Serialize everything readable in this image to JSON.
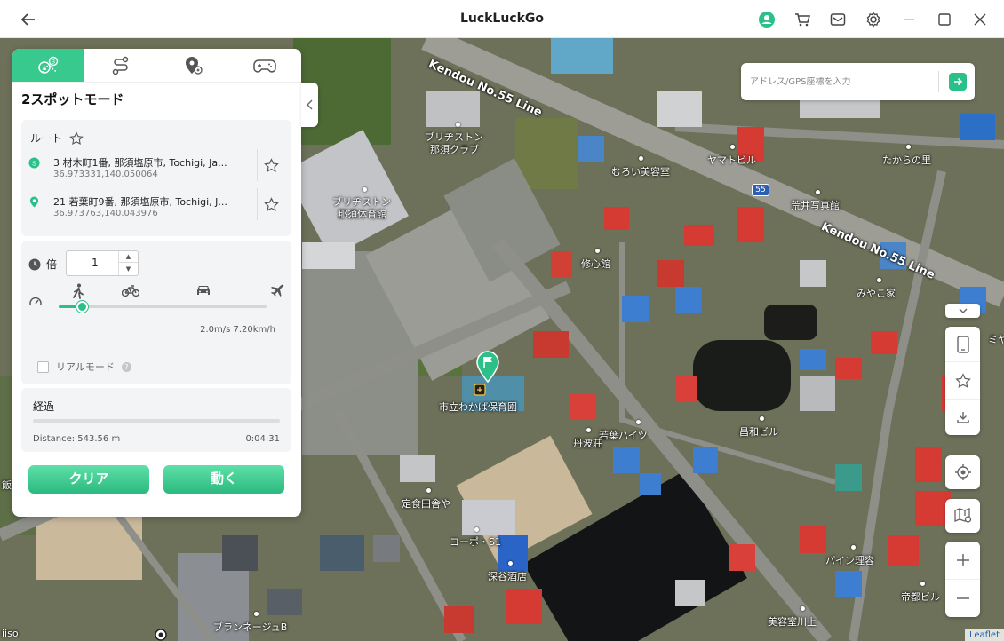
{
  "app": {
    "title": "LuckLuckGo"
  },
  "titlebar": {
    "icons": [
      "back-arrow-icon",
      "user-icon",
      "cart-icon",
      "mail-icon",
      "gear-icon",
      "minimize-icon",
      "maximize-icon",
      "close-icon"
    ]
  },
  "search": {
    "placeholder": "アドレス/GPS座標を入力",
    "value": ""
  },
  "panel": {
    "tabs": [
      {
        "icon": "two-spot-icon",
        "active": true
      },
      {
        "icon": "multi-spot-icon",
        "active": false
      },
      {
        "icon": "teleport-icon",
        "active": false
      },
      {
        "icon": "gamepad-icon",
        "active": false
      }
    ],
    "mode_title": "2スポットモード",
    "route": {
      "label": "ルート",
      "start": {
        "address": "3 材木町1番, 那須塩原市, Tochigi, Ja...",
        "coords": "36.973331,140.050064"
      },
      "end": {
        "address": "21 若葉町9番, 那須塩原市, Tochigi, J...",
        "coords": "36.973763,140.043976"
      }
    },
    "speed": {
      "multiplier_label": "倍",
      "multiplier_value": "1",
      "slider_fraction": 0.11,
      "speed_text": "2.0m/s  7.20km/h",
      "real_mode_label": "リアルモード",
      "real_mode_checked": false
    },
    "progress": {
      "title": "経過",
      "fraction": 0.0,
      "distance": "Distance: 543.56 m",
      "elapsed": "0:04:31"
    },
    "buttons": {
      "clear": "クリア",
      "move": "動く"
    }
  },
  "map": {
    "labels": [
      {
        "text": "ブリヂストン",
        "id": "bs1"
      },
      {
        "text": "那須クラブ",
        "id": "bs2"
      },
      {
        "text": "ブリヂストン",
        "id": "bs3"
      },
      {
        "text": "那須体育館",
        "id": "bs4"
      },
      {
        "text": "むろい美容室",
        "id": "muroi"
      },
      {
        "text": "ヤマトビル",
        "id": "yamato"
      },
      {
        "text": "たからの里",
        "id": "takara"
      },
      {
        "text": "荒井写真館",
        "id": "arai"
      },
      {
        "text": "修心館",
        "id": "shushin"
      },
      {
        "text": "みやこ家",
        "id": "miyako"
      },
      {
        "text": "市立わかば保育園",
        "id": "wakaba"
      },
      {
        "text": "若葉ハイツ",
        "id": "wakabahaitsu"
      },
      {
        "text": "丹波荘",
        "id": "tanba"
      },
      {
        "text": "昌和ビル",
        "id": "showa"
      },
      {
        "text": "定食田舎や",
        "id": "teishoku"
      },
      {
        "text": "コーポ・S1",
        "id": "corpo"
      },
      {
        "text": "深谷酒店",
        "id": "fukaya"
      },
      {
        "text": "パイン理容",
        "id": "pine"
      },
      {
        "text": "帝都ビル",
        "id": "teito"
      },
      {
        "text": "美容室川上",
        "id": "kawakami"
      },
      {
        "text": "ブランネージュB",
        "id": "blanc"
      },
      {
        "text": "ミヤ",
        "id": "miya"
      },
      {
        "text": "iiso",
        "id": "iiso"
      },
      {
        "text": "飯",
        "id": "meshi"
      }
    ],
    "roads": [
      {
        "text": "Kendou No.55 Line",
        "id": "road1"
      },
      {
        "text": "Kendou No.55 Line",
        "id": "road2"
      }
    ],
    "shield": "55",
    "attribution": "Leaflet"
  },
  "right_toolbar": {
    "icons": [
      "chevron-down-icon",
      "phone-icon",
      "star-icon",
      "download-icon",
      "locate-icon",
      "map-layers-icon",
      "zoom-in-icon",
      "zoom-out-icon"
    ]
  },
  "colors": {
    "accent": "#2bbf8a",
    "tab_active": "#38c98f"
  }
}
